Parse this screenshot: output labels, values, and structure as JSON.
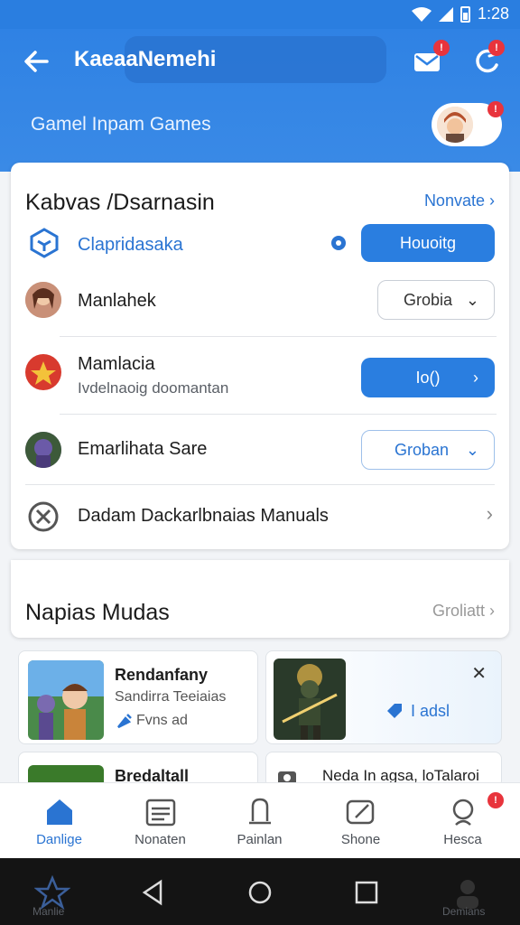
{
  "status_bar": {
    "time": "1:28"
  },
  "header": {
    "title": "KaeaaNemehi",
    "subtitle": "Gamel Inpam Games",
    "mail_badge": "!",
    "refresh_badge": "!",
    "avatar_badge": "!"
  },
  "card": {
    "title": "Kabvas /Dsarnasin",
    "link": "Nonvate",
    "rows": [
      {
        "name": "Clapridasaka",
        "button": "Houoitg"
      },
      {
        "name": "Manlahek",
        "button": "Grobia"
      },
      {
        "name": "Mamlacia",
        "sub": "Ivdelnaoig doomantan",
        "button": "Io()"
      },
      {
        "name": "Emarlihata Sare",
        "button": "Groban"
      },
      {
        "name": "Dadam Dackarlbnaias Manuals"
      }
    ]
  },
  "section2": {
    "title": "Napias Mudas",
    "link": "Groliatt"
  },
  "tiles": [
    {
      "title": "Rendanfany",
      "sub": "Sandirra Teeiaias",
      "meta": "Fvns ad"
    },
    {
      "action": "I adsl"
    },
    {
      "title": "Bredaltall"
    },
    {
      "title": "Neda In agsa, loTalaroi"
    }
  ],
  "bottom_nav": [
    {
      "label": "Danlige"
    },
    {
      "label": "Nonaten"
    },
    {
      "label": "Painlan"
    },
    {
      "label": "Shone"
    },
    {
      "label": "Hesca",
      "badge": "!"
    }
  ],
  "system_nav": {
    "left_label": "Manlie",
    "right_label": "Demians"
  },
  "colors": {
    "primary": "#2a7ee0",
    "badge": "#e8343c"
  }
}
